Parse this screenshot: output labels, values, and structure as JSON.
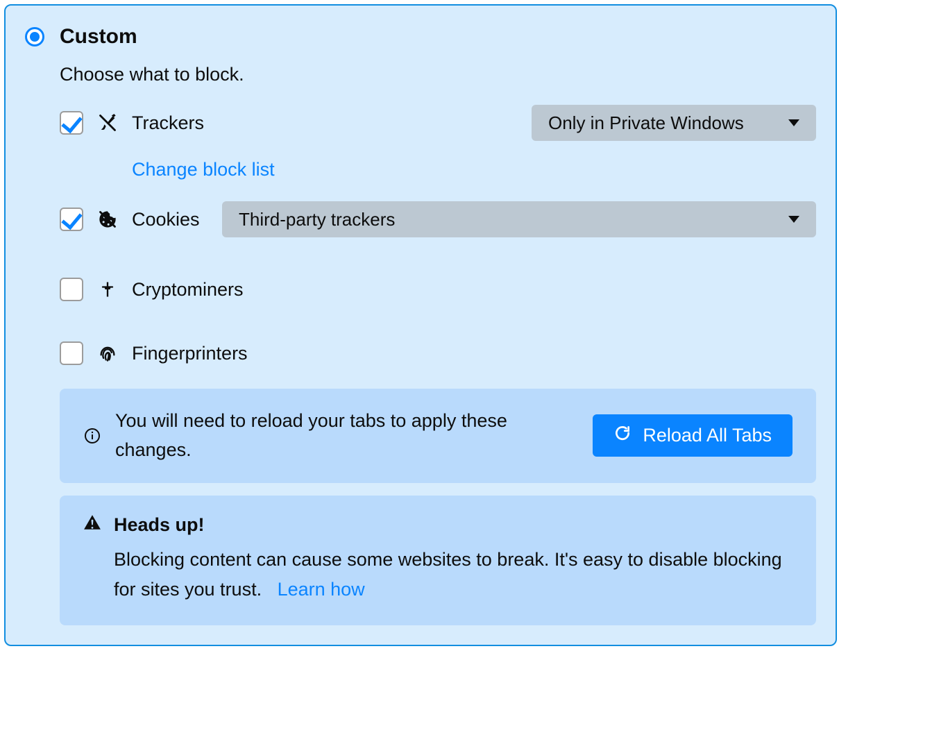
{
  "header": {
    "title": "Custom",
    "subtitle": "Choose what to block."
  },
  "options": {
    "trackers": {
      "label": "Trackers",
      "checked": true,
      "select": "Only in Private Windows",
      "change_link": "Change block list"
    },
    "cookies": {
      "label": "Cookies",
      "checked": true,
      "select": "Third-party trackers"
    },
    "cryptominers": {
      "label": "Cryptominers",
      "checked": false
    },
    "fingerprinters": {
      "label": "Fingerprinters",
      "checked": false
    }
  },
  "reload_notice": {
    "text": "You will need to reload your tabs to apply these changes.",
    "button": "Reload All Tabs"
  },
  "warning": {
    "title": "Heads up!",
    "body": "Blocking content can cause some websites to break. It's easy to disable blocking for sites you trust.",
    "link": "Learn how"
  }
}
